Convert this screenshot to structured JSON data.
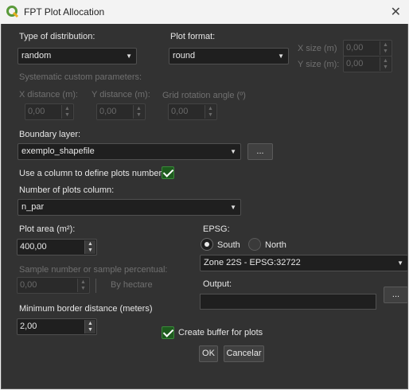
{
  "window": {
    "title": "FPT Plot Allocation",
    "logo_color": "#5a9a3a",
    "accent": "#1e5a1e"
  },
  "distribution": {
    "label": "Type of distribution:",
    "value": "random"
  },
  "plot_format": {
    "label": "Plot format:",
    "value": "round"
  },
  "size": {
    "x_label": "X size (m)",
    "x_value": "0,00",
    "y_label": "Y size (m):",
    "y_value": "0,00"
  },
  "systematic": {
    "header": "Systematic custom parameters:",
    "x_label": "X distance (m):",
    "x_value": "0,00",
    "y_label": "Y distance (m):",
    "y_value": "0,00",
    "rot_label": "Grid rotation angle (º)",
    "rot_value": "0,00"
  },
  "boundary": {
    "label": "Boundary layer:",
    "value": "exemplo_shapefile",
    "browse": "..."
  },
  "use_column": {
    "label": "Use a column to define plots number",
    "checked": true
  },
  "plots_column": {
    "label": "Number of plots column:",
    "value": "n_par"
  },
  "plot_area": {
    "label": "Plot area (m²):",
    "value": "400,00"
  },
  "sample": {
    "label": "Sample number or sample percentual:",
    "value": "0,00",
    "hectare": "By hectare"
  },
  "border": {
    "label": "Minimum border distance (meters)",
    "value": "2,00"
  },
  "epsg": {
    "label": "EPSG:",
    "south": "South",
    "north": "North",
    "zone": "Zone 22S - EPSG:32722"
  },
  "output": {
    "label": "Output:",
    "value": "",
    "browse": "..."
  },
  "buffer": {
    "label": "Create buffer for plots",
    "checked": true
  },
  "actions": {
    "ok": "OK",
    "cancel": "Cancelar"
  }
}
